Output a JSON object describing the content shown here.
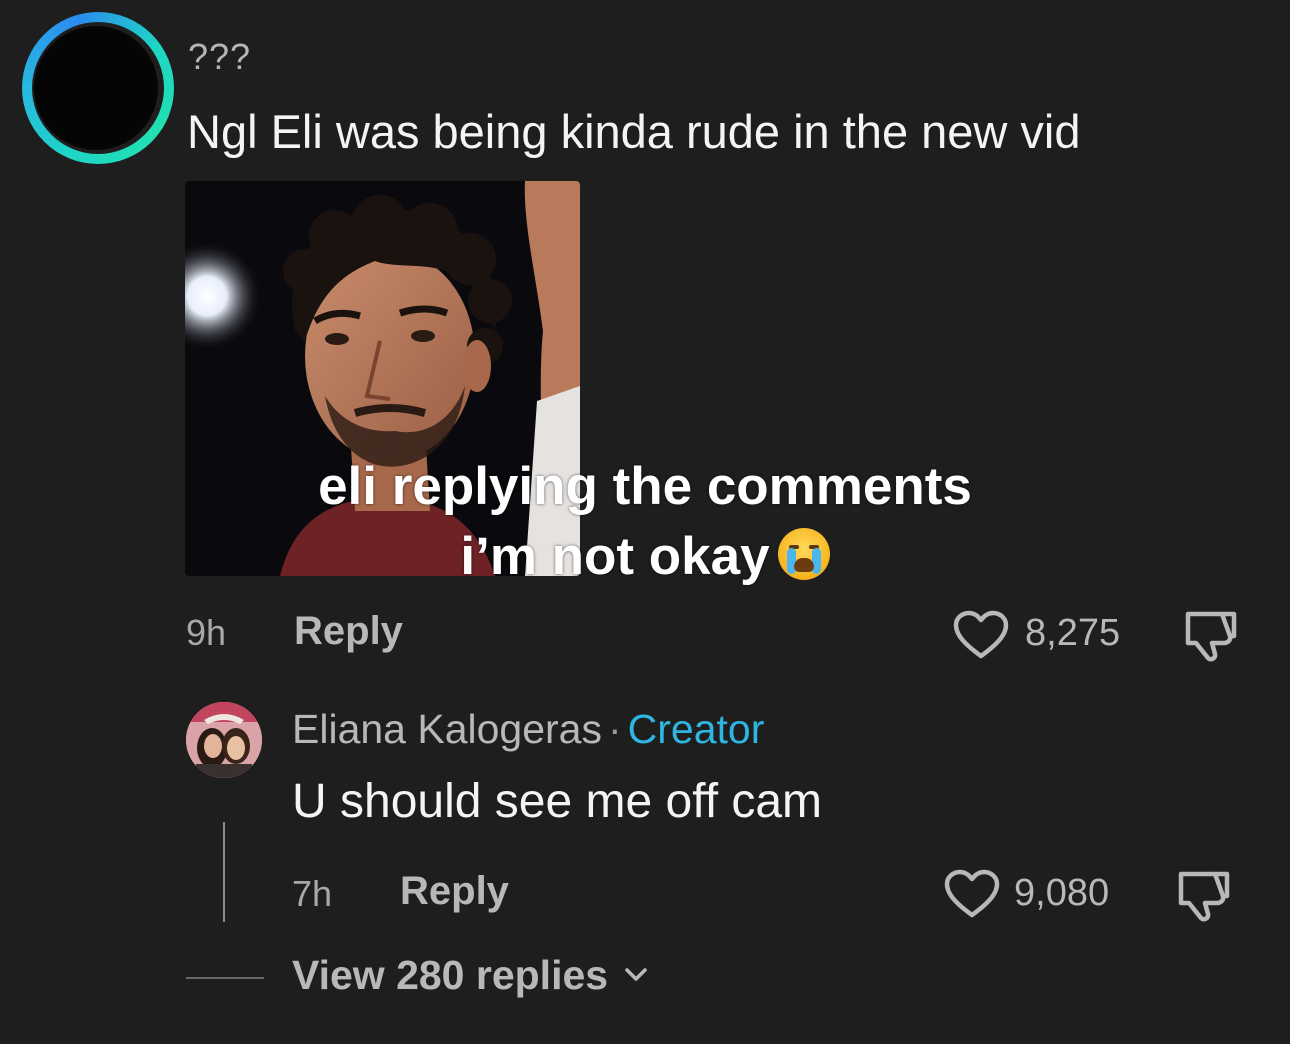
{
  "comment": {
    "username": "???",
    "text": "Ngl Eli was being kinda rude in the new vid",
    "sticker_caption_line1": "eli replying the comments",
    "sticker_caption_line2": "i’m not okay",
    "sticker_emoji": "loudly-crying-face-emoji",
    "time": "9h",
    "reply_label": "Reply",
    "likes": "8,275",
    "avatar_ring_color": "#1fd6c4"
  },
  "reply": {
    "author": "Eliana Kalogeras",
    "separator": "·",
    "badge": "Creator",
    "badge_color": "#2eb6e0",
    "text": "U should see me off cam",
    "time": "7h",
    "reply_label": "Reply",
    "likes": "9,080"
  },
  "thread": {
    "view_replies_label": "View 280 replies"
  },
  "icons": {
    "like": "heart-outline-icon",
    "dislike": "thumbs-down-icon",
    "expand": "chevron-down-icon"
  }
}
